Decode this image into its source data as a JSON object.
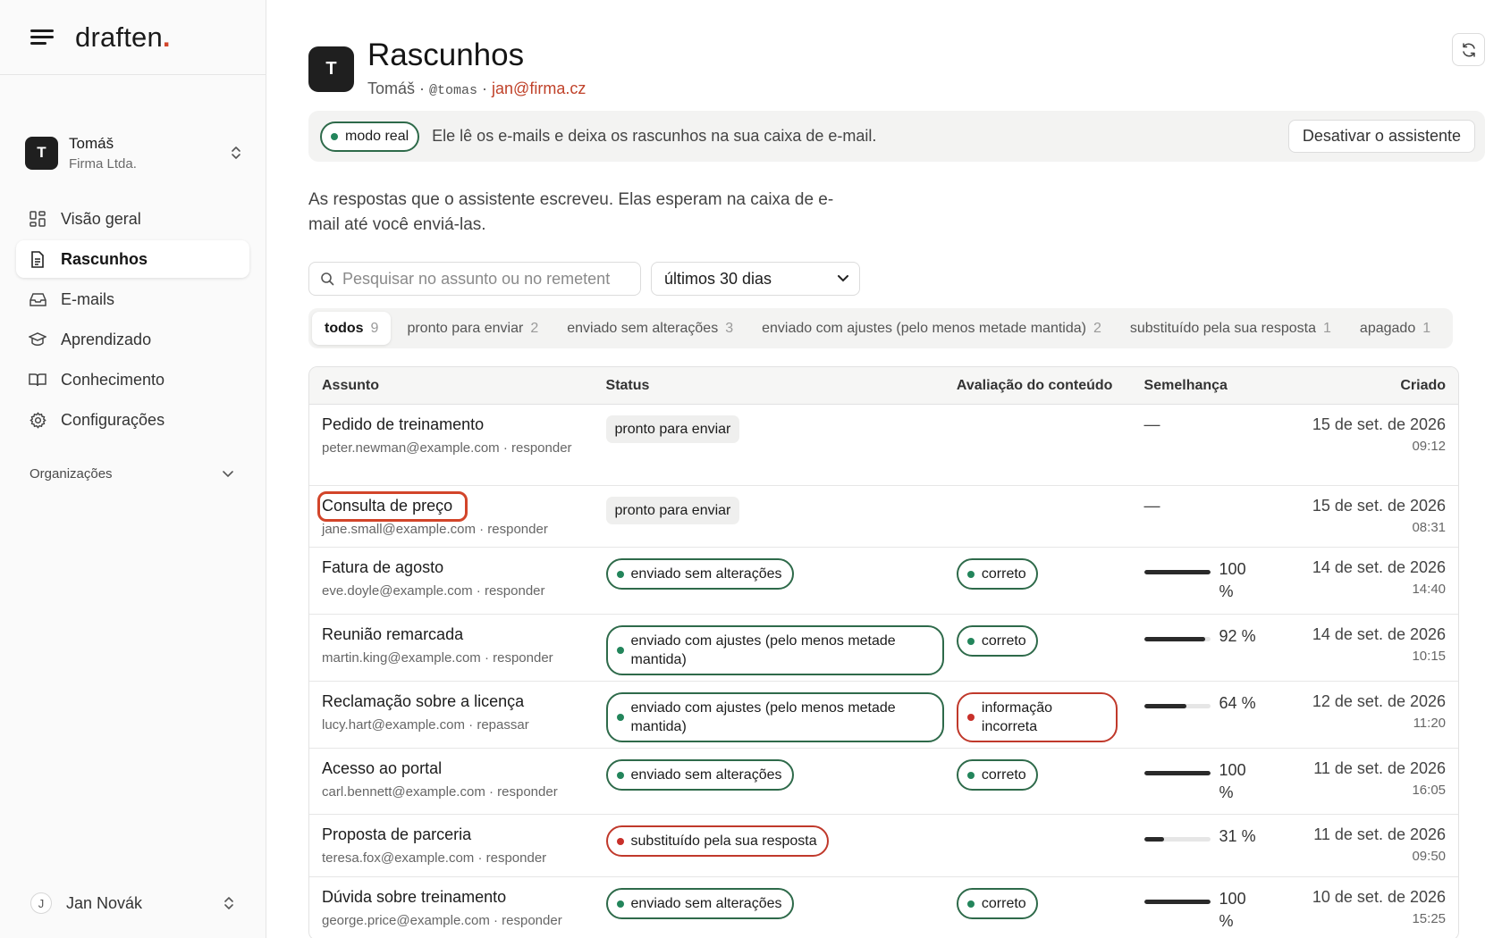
{
  "brand": {
    "name": "draften",
    "dot": "."
  },
  "org": {
    "avatar": "T",
    "name": "Tomáš",
    "company": "Firma Ltda."
  },
  "nav": [
    {
      "label": "Visão geral",
      "icon": "dashboard-icon"
    },
    {
      "label": "Rascunhos",
      "icon": "document-icon",
      "active": true
    },
    {
      "label": "E-mails",
      "icon": "inbox-icon"
    },
    {
      "label": "Aprendizado",
      "icon": "graduation-cap-icon"
    },
    {
      "label": "Conhecimento",
      "icon": "book-icon"
    },
    {
      "label": "Configurações",
      "icon": "gear-icon"
    }
  ],
  "organizations_label": "Organizações",
  "user": {
    "avatar": "J",
    "name": "Jan Novák"
  },
  "header": {
    "avatar": "T",
    "title": "Rascunhos",
    "name": "Tomáš",
    "sep1": " · ",
    "handle": "@tomas",
    "sep2": " · ",
    "email": "jan@firma.cz"
  },
  "banner": {
    "mode": "modo real",
    "text": "Ele lê os e-mails e deixa os rascunhos na sua caixa de e-mail.",
    "button": "Desativar o assistente"
  },
  "description": "As respostas que o assistente escreveu. Elas esperam na caixa de e-mail até você enviá-las.",
  "search": {
    "placeholder": "Pesquisar no assunto ou no remetent"
  },
  "period": {
    "selected": "últimos 30 dias"
  },
  "tabs": [
    {
      "label": "todos",
      "count": "9",
      "active": true
    },
    {
      "label": "pronto para enviar",
      "count": "2"
    },
    {
      "label": "enviado sem alterações",
      "count": "3"
    },
    {
      "label": "enviado com ajustes (pelo menos metade mantida)",
      "count": "2"
    },
    {
      "label": "substituído pela sua resposta",
      "count": "1"
    },
    {
      "label": "apagado",
      "count": "1"
    }
  ],
  "table": {
    "headers": {
      "subject": "Assunto",
      "status": "Status",
      "rating": "Avaliação do conteúdo",
      "similarity": "Semelhança",
      "created": "Criado"
    },
    "rows": [
      {
        "subject": "Pedido de treinamento",
        "meta": "peter.newman@example.com · responder",
        "status": "pronto para enviar",
        "status_style": "gray",
        "rating": "",
        "similarity": "—",
        "sim_value": null,
        "date": "15 de set. de 2026",
        "time": "09:12"
      },
      {
        "subject": "Consulta de preço",
        "meta": "jane.small@example.com · responder",
        "status": "pronto para enviar",
        "status_style": "gray",
        "rating": "",
        "similarity": "—",
        "sim_value": null,
        "date": "15 de set. de 2026",
        "time": "08:31",
        "highlighted": true
      },
      {
        "subject": "Fatura de agosto",
        "meta": "eve.doyle@example.com · responder",
        "status": "enviado sem alterações",
        "status_style": "green",
        "rating": "correto",
        "rating_style": "green",
        "similarity": "100 %",
        "sim_value": 1.0,
        "date": "14 de set. de 2026",
        "time": "14:40"
      },
      {
        "subject": "Reunião remarcada",
        "meta": "martin.king@example.com · responder",
        "status": "enviado com ajustes (pelo menos metade mantida)",
        "status_style": "green-wide",
        "rating": "correto",
        "rating_style": "green",
        "similarity": "92 %",
        "sim_value": 0.92,
        "date": "14 de set. de 2026",
        "time": "10:15"
      },
      {
        "subject": "Reclamação sobre a licença",
        "meta": "lucy.hart@example.com · repassar",
        "status": "enviado com ajustes (pelo menos metade mantida)",
        "status_style": "green-wide",
        "rating": "informação incorreta",
        "rating_style": "red",
        "similarity": "64 %",
        "sim_value": 0.64,
        "date": "12 de set. de 2026",
        "time": "11:20"
      },
      {
        "subject": "Acesso ao portal",
        "meta": "carl.bennett@example.com · responder",
        "status": "enviado sem alterações",
        "status_style": "green",
        "rating": "correto",
        "rating_style": "green",
        "similarity": "100 %",
        "sim_value": 1.0,
        "date": "11 de set. de 2026",
        "time": "16:05"
      },
      {
        "subject": "Proposta de parceria",
        "meta": "teresa.fox@example.com · responder",
        "status": "substituído pela sua resposta",
        "status_style": "red",
        "rating": "",
        "similarity": "31 %",
        "sim_value": 0.31,
        "date": "11 de set. de 2026",
        "time": "09:50"
      },
      {
        "subject": "Dúvida sobre treinamento",
        "meta": "george.price@example.com · responder",
        "status": "enviado sem alterações",
        "status_style": "green",
        "rating": "correto",
        "rating_style": "green",
        "similarity": "100 %",
        "sim_value": 1.0,
        "date": "10 de set. de 2026",
        "time": "15:25"
      }
    ]
  },
  "colors": {
    "accent": "#d2452a",
    "green": "#23855b",
    "red": "#c8302a"
  }
}
